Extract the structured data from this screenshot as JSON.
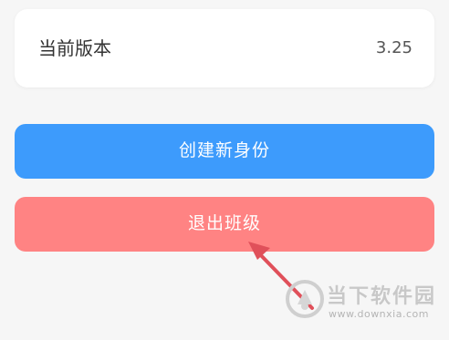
{
  "version": {
    "label": "当前版本",
    "value": "3.25"
  },
  "actions": {
    "create_identity": "创建新身份",
    "exit_class": "退出班级"
  },
  "watermark": {
    "brand": "当下软件园",
    "url": "www.downxia.com"
  },
  "colors": {
    "create_button": "#3d9bfc",
    "exit_button": "#ff8383",
    "arrow": "#e0505a",
    "background": "#f6f6f6"
  }
}
